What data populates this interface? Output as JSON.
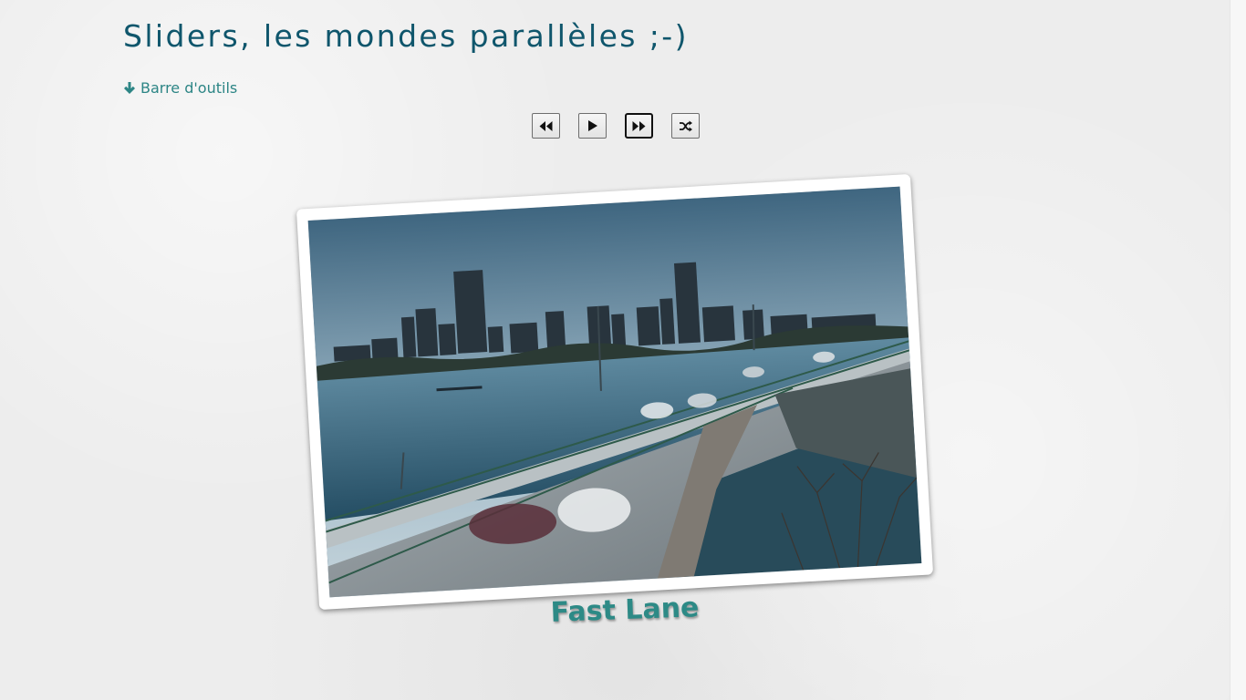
{
  "page": {
    "title": "Sliders, les mondes parallèles ;-)"
  },
  "toolbar_link": {
    "label": "Barre d'outils",
    "icon": "arrow-down-icon"
  },
  "controls": [
    {
      "name": "previous",
      "icon": "rewind-icon",
      "active": false
    },
    {
      "name": "play",
      "icon": "play-icon",
      "active": false
    },
    {
      "name": "next",
      "icon": "fast-forward-icon",
      "active": true
    },
    {
      "name": "shuffle",
      "icon": "shuffle-icon",
      "active": false
    }
  ],
  "slide": {
    "caption": "Fast Lane",
    "image": "city-skyline-highway-photo"
  },
  "colors": {
    "title": "#0f566c",
    "link": "#2c8585",
    "caption": "#2d8a86",
    "background": "#ededed"
  }
}
